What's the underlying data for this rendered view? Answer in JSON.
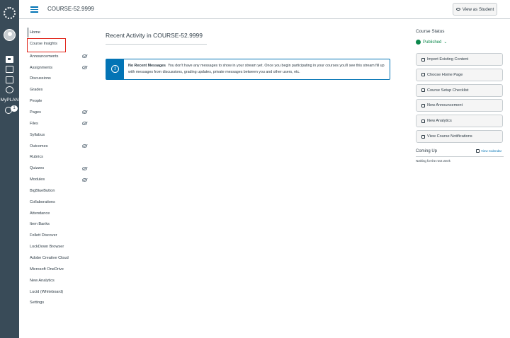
{
  "header": {
    "breadcrumb": "COURSE-52.9999",
    "view_as_student": "View as Student"
  },
  "global_nav": {
    "myplan_label": "MyPLAN",
    "help_badge": "1"
  },
  "course_nav": {
    "items": [
      {
        "label": "Home",
        "hidden": false
      },
      {
        "label": "Course Insights",
        "hidden": false
      },
      {
        "label": "Announcements",
        "hidden": true
      },
      {
        "label": "Assignments",
        "hidden": true
      },
      {
        "label": "Discussions",
        "hidden": false
      },
      {
        "label": "Grades",
        "hidden": false
      },
      {
        "label": "People",
        "hidden": false
      },
      {
        "label": "Pages",
        "hidden": true
      },
      {
        "label": "Files",
        "hidden": true
      },
      {
        "label": "Syllabus",
        "hidden": false
      },
      {
        "label": "Outcomes",
        "hidden": true
      },
      {
        "label": "Rubrics",
        "hidden": false
      },
      {
        "label": "Quizzes",
        "hidden": true
      },
      {
        "label": "Modules",
        "hidden": true
      },
      {
        "label": "BigBlueButton",
        "hidden": false
      },
      {
        "label": "Collaborations",
        "hidden": false
      },
      {
        "label": "Attendance",
        "hidden": false
      },
      {
        "label": "Item Banks",
        "hidden": false
      },
      {
        "label": "Follett Discover",
        "hidden": false
      },
      {
        "label": "LockDown Browser",
        "hidden": false
      },
      {
        "label": "Adobe Creative Cloud",
        "hidden": false
      },
      {
        "label": "Microsoft OneDrive",
        "hidden": false
      },
      {
        "label": "New Analytics",
        "hidden": false
      },
      {
        "label": "Lucid (Whiteboard)",
        "hidden": false
      },
      {
        "label": "Settings",
        "hidden": false
      }
    ]
  },
  "main": {
    "title": "Recent Activity in COURSE-52.9999",
    "alert_heading": "No Recent Messages",
    "alert_body": "You don't have any messages to show in your stream yet. Once you begin participating in your courses you'll see this stream fill up with messages from discussions, grading updates, private messages between you and other users, etc."
  },
  "sidebar": {
    "status_label": "Course Status",
    "published_label": "Published",
    "buttons": [
      "Import Existing Content",
      "Choose Home Page",
      "Course Setup Checklist",
      "New Announcement",
      "New Analytics",
      "View Course Notifications"
    ],
    "coming_up": "Coming Up",
    "view_calendar": "View Calendar",
    "nothing_next_week": "Nothing for the next week"
  },
  "colors": {
    "global_nav_bg": "#394b58",
    "link": "#0374b5",
    "published": "#0b874b",
    "highlight_box": "#e0251b"
  }
}
